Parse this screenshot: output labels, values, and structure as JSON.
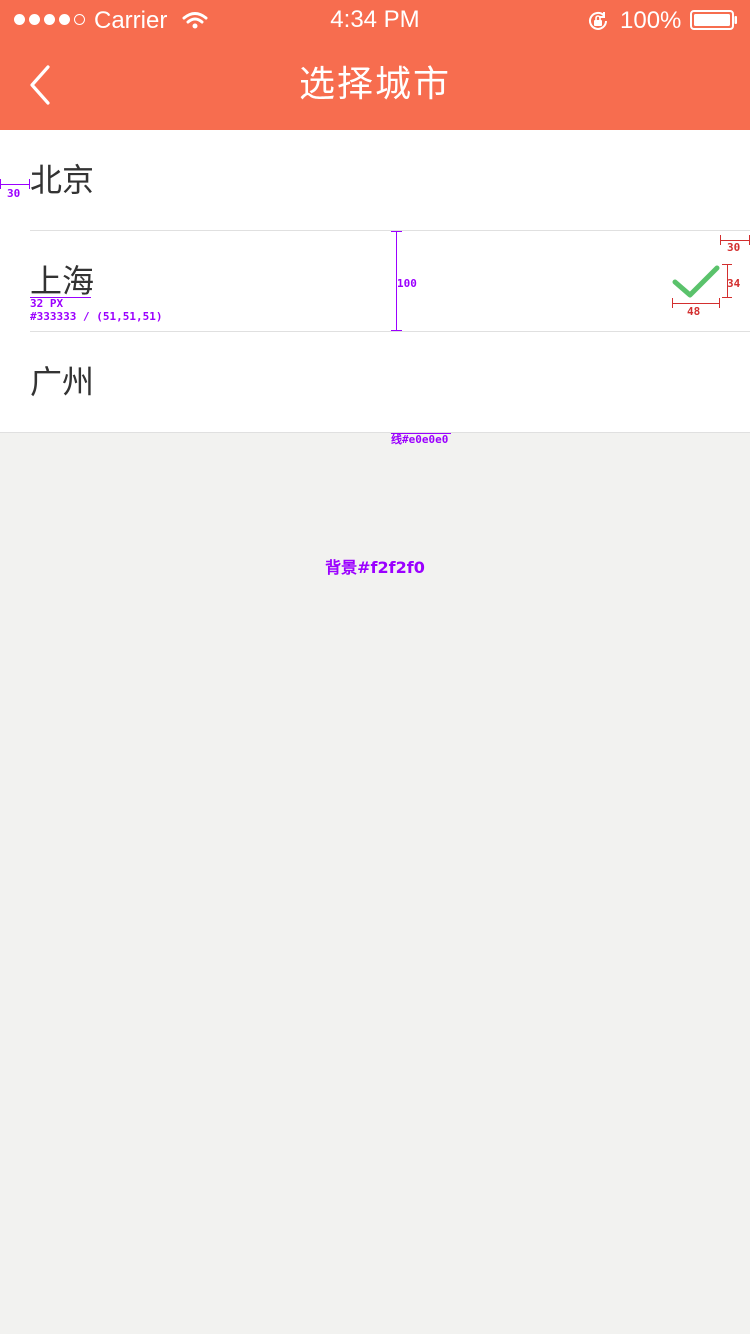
{
  "status_bar": {
    "carrier": "Carrier",
    "time": "4:34 PM",
    "battery": "100%",
    "signal_icon": "signal-dots-icon",
    "wifi_icon": "wifi-icon",
    "rotation_icon": "rotation-lock-icon",
    "battery_icon": "battery-icon"
  },
  "nav": {
    "title": "选择城市",
    "back_icon": "back-chevron-icon",
    "background_color": "#f76d4f"
  },
  "cities": [
    {
      "name": "北京",
      "selected": false
    },
    {
      "name": "上海",
      "selected": true,
      "check_icon": "checkmark-icon",
      "check_color": "#5ac26b"
    },
    {
      "name": "广州",
      "selected": false
    }
  ],
  "annotations": {
    "left_margin": "30",
    "row_height": "100",
    "right_margin": "30",
    "check_height": "34",
    "check_width": "48",
    "text_size": "32 PX",
    "text_color": "#333333 / (51,51,51)",
    "divider_color": "线#e0e0e0",
    "background": "背景#f2f2f0"
  },
  "colors": {
    "text": "#333333",
    "divider": "#e0e0e0",
    "background": "#f2f2f0",
    "annotation_purple": "#9b00ff",
    "annotation_red": "#d32f2f"
  }
}
